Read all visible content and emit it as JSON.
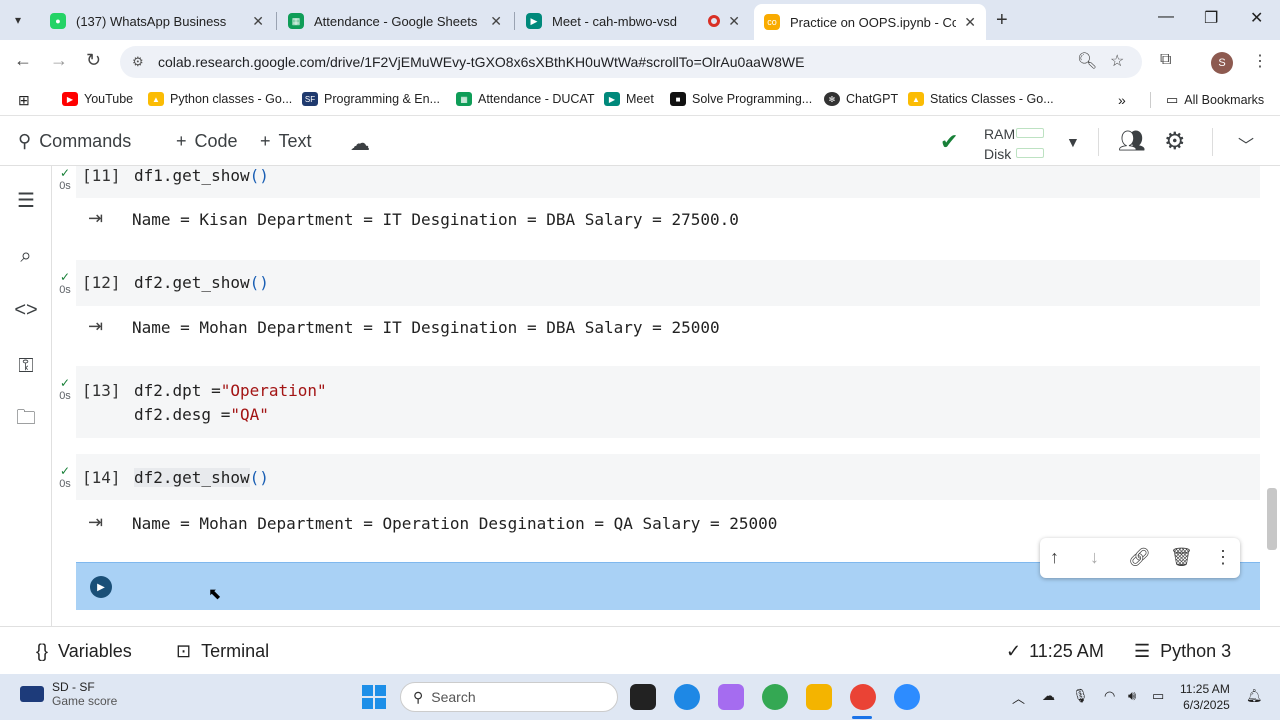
{
  "browser": {
    "tabs": [
      {
        "title": "(137) WhatsApp Business",
        "favicon": "whatsapp-icon",
        "active": false
      },
      {
        "title": "Attendance - Google Sheets",
        "favicon": "sheets-icon",
        "active": false
      },
      {
        "title": "Meet - cah-mbwo-vsd",
        "favicon": "meet-icon",
        "active": false
      },
      {
        "title": "Practice on OOPS.ipynb - Colab",
        "favicon": "colab-icon",
        "active": true
      }
    ],
    "url": "colab.research.google.com/drive/1F2VjEMuWEvy-tGXO8x6sXBthKH0uWtWa#scrollTo=OlrAu0aaW8WE",
    "profile_initial": "S",
    "bookmarks": [
      {
        "label": "YouTube",
        "icon": "youtube-icon"
      },
      {
        "label": "Python classes - Go...",
        "icon": "drive-icon"
      },
      {
        "label": "Programming & En...",
        "icon": "bookmark-icon"
      },
      {
        "label": "Attendance - DUCAT",
        "icon": "sheets-icon"
      },
      {
        "label": "Meet",
        "icon": "meet-icon"
      },
      {
        "label": "Solve Programming...",
        "icon": "bookmark-icon"
      },
      {
        "label": "ChatGPT",
        "icon": "chatgpt-icon"
      },
      {
        "label": "Statics Classes - Go...",
        "icon": "drive-icon"
      }
    ],
    "all_bookmarks": "All Bookmarks"
  },
  "colab": {
    "toolbar": {
      "commands": "Commands",
      "code": "Code",
      "text": "Text",
      "ram": "RAM",
      "disk": "Disk"
    },
    "cells": [
      {
        "exec": "[11]",
        "time": "0s",
        "code": "df1.get_show",
        "output": "Name = Kisan Department = IT Desgination = DBA Salary = 27500.0"
      },
      {
        "exec": "[12]",
        "time": "0s",
        "code": "df2.get_show",
        "output": "Name = Mohan Department = IT Desgination = DBA Salary = 25000"
      },
      {
        "exec": "[13]",
        "time": "0s",
        "code_line1_prefix": "df2.dpt =",
        "code_line1_str": "\"Operation\"",
        "code_line2_prefix": "df2.desg =",
        "code_line2_str": "\"QA\""
      },
      {
        "exec": "[14]",
        "time": "0s",
        "code": "df2.get_show",
        "output": "Name = Mohan Department = Operation Desgination = QA Salary = 25000"
      }
    ],
    "statusbar": {
      "variables": "Variables",
      "terminal": "Terminal",
      "time": "11:25 AM",
      "runtime": "Python 3"
    }
  },
  "taskbar": {
    "weather_title": "SD - SF",
    "weather_sub": "Game score",
    "search_placeholder": "Search",
    "clock_time": "11:25 AM",
    "clock_date": "6/3/2025"
  }
}
